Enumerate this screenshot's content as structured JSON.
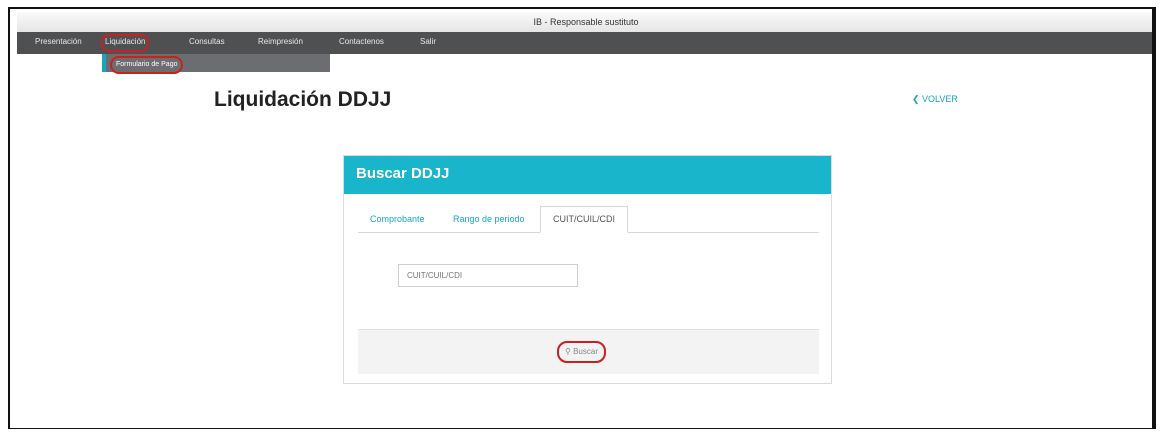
{
  "window": {
    "title": "IB - Responsable sustituto"
  },
  "nav": {
    "items": [
      "Presentación",
      "Liquidación",
      "Consultas",
      "Reimpresión",
      "Contactenos",
      "Salir"
    ],
    "active": "Liquidación"
  },
  "submenu": {
    "item": "Formulario de Pago"
  },
  "page": {
    "title": "Liquidación DDJJ",
    "back_link": "VOLVER"
  },
  "panel": {
    "title": "Buscar DDJJ",
    "tabs": [
      "Comprobante",
      "Rango de periodo",
      "CUIT/CUIL/CDI"
    ],
    "active_tab": "CUIT/CUIL/CDI",
    "input_placeholder": "CUIT/CUIL/CDI",
    "search_button": "Buscar"
  },
  "colors": {
    "accent": "#19b5cb",
    "highlight": "#cc1f1f",
    "nav_bg": "#4e5052"
  }
}
